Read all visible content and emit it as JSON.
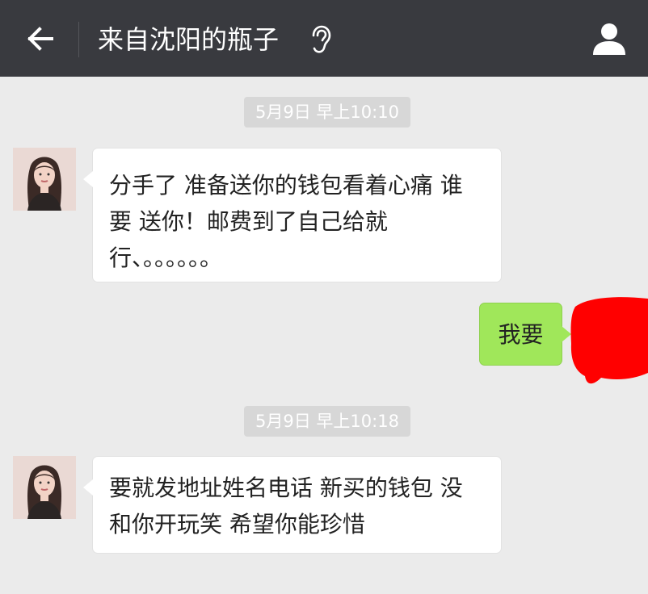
{
  "header": {
    "back_icon": "arrow-left-icon",
    "title": "来自沈阳的瓶子",
    "ear_icon": "ear-icon",
    "profile_icon": "person-icon"
  },
  "messages": [
    {
      "timestamp": "5月9日 早上10:10",
      "from": "other",
      "lines": [
        "分手了 准备送你的钱包看着心痛 谁",
        "要 送你！邮费到了自己给就",
        "行、。。。。。。"
      ]
    },
    {
      "from": "self",
      "lines": [
        "我要"
      ]
    },
    {
      "timestamp": "5月9日 早上10:18",
      "from": "other",
      "lines": [
        "要就发地址姓名电话 新买的钱包 没",
        "和你开玩笑  希望你能珍惜"
      ]
    }
  ],
  "colors": {
    "header_bg": "#393a3f",
    "chat_bg": "#ebebeb",
    "incoming_bubble": "#ffffff",
    "outgoing_bubble": "#a0e75a",
    "timestamp_bg": "#d7d7d7",
    "redaction": "#ff0000"
  }
}
